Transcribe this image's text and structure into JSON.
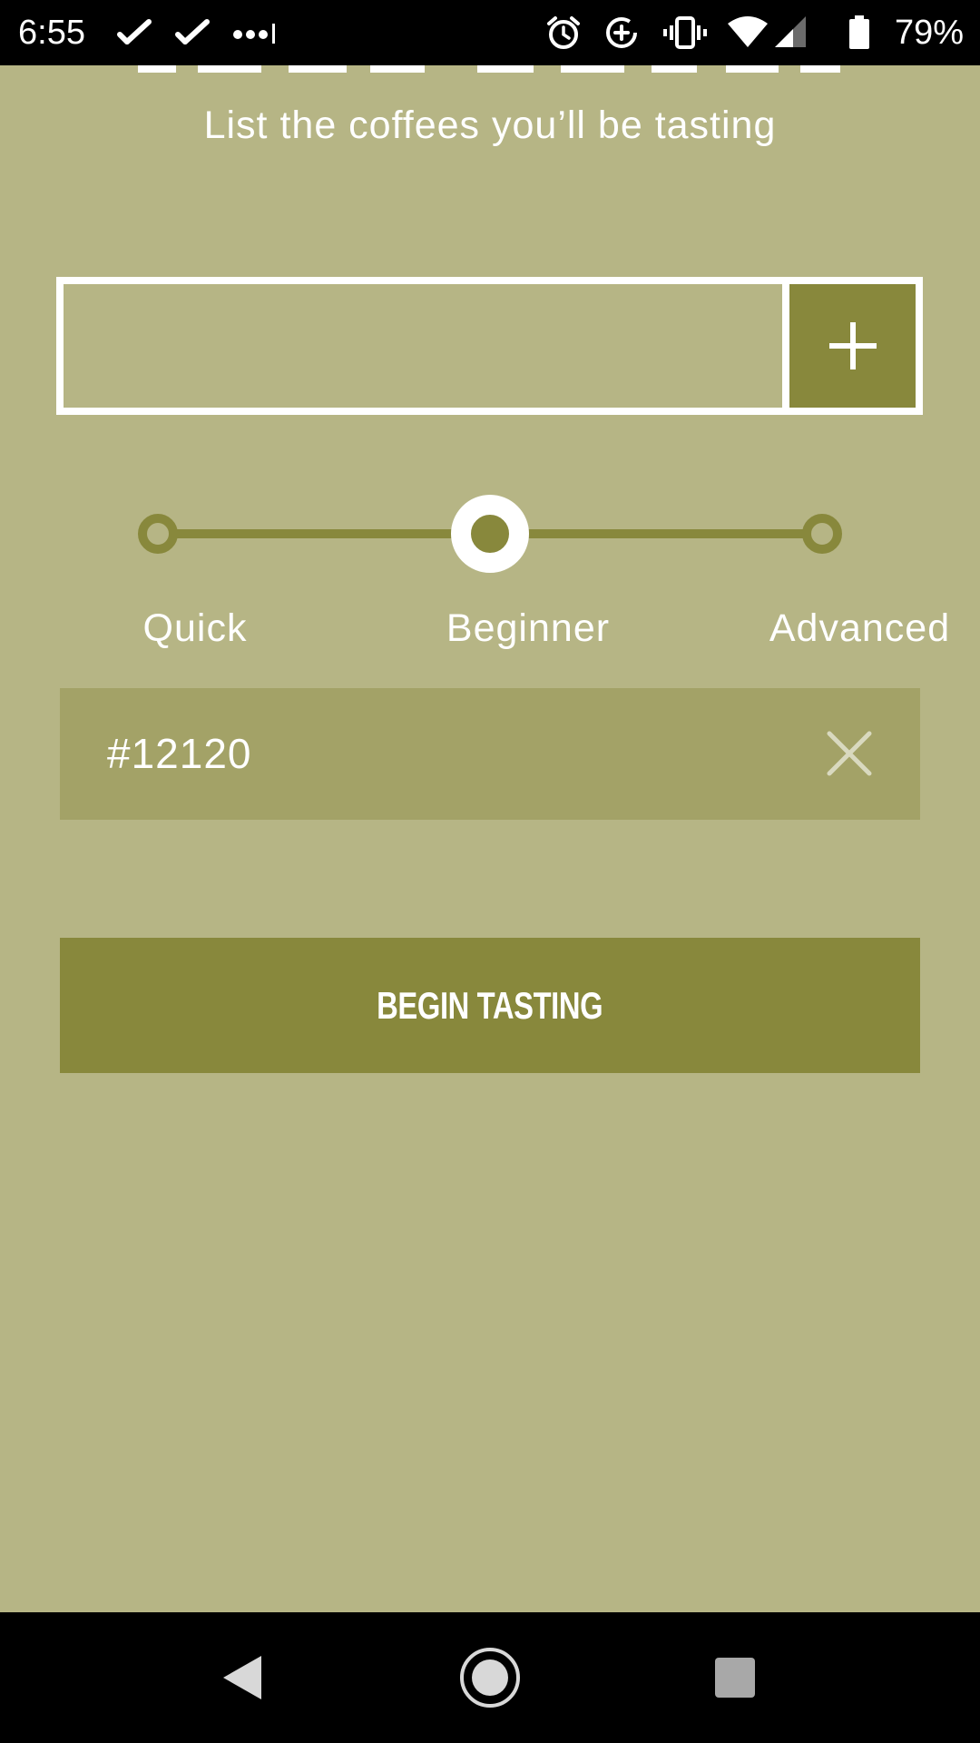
{
  "status_bar": {
    "time": "6:55",
    "battery": "79%",
    "icons": [
      "phone-check-icon",
      "phone-check-icon",
      "more-dots-icon",
      "alarm-icon",
      "data-saver-icon",
      "vibrate-icon",
      "wifi-icon",
      "signal-icon",
      "battery-icon"
    ]
  },
  "header": {
    "subtitle": "List the coffees you’ll be tasting"
  },
  "add_coffee": {
    "value": "",
    "placeholder": "",
    "add_icon": "plus-icon"
  },
  "level": {
    "selected": "Beginner",
    "options": [
      "Quick",
      "Beginner",
      "Advanced"
    ]
  },
  "coffees": [
    {
      "name": "#12120",
      "remove_icon": "close-icon"
    }
  ],
  "begin_button": {
    "label": "BEGIN TASTING"
  },
  "nav_bar": {
    "icons": [
      "back-icon",
      "home-icon",
      "recents-icon"
    ]
  },
  "colors": {
    "background": "#b6b585",
    "accent": "#88883c",
    "list_item": "#a3a267",
    "text": "#ffffff"
  }
}
